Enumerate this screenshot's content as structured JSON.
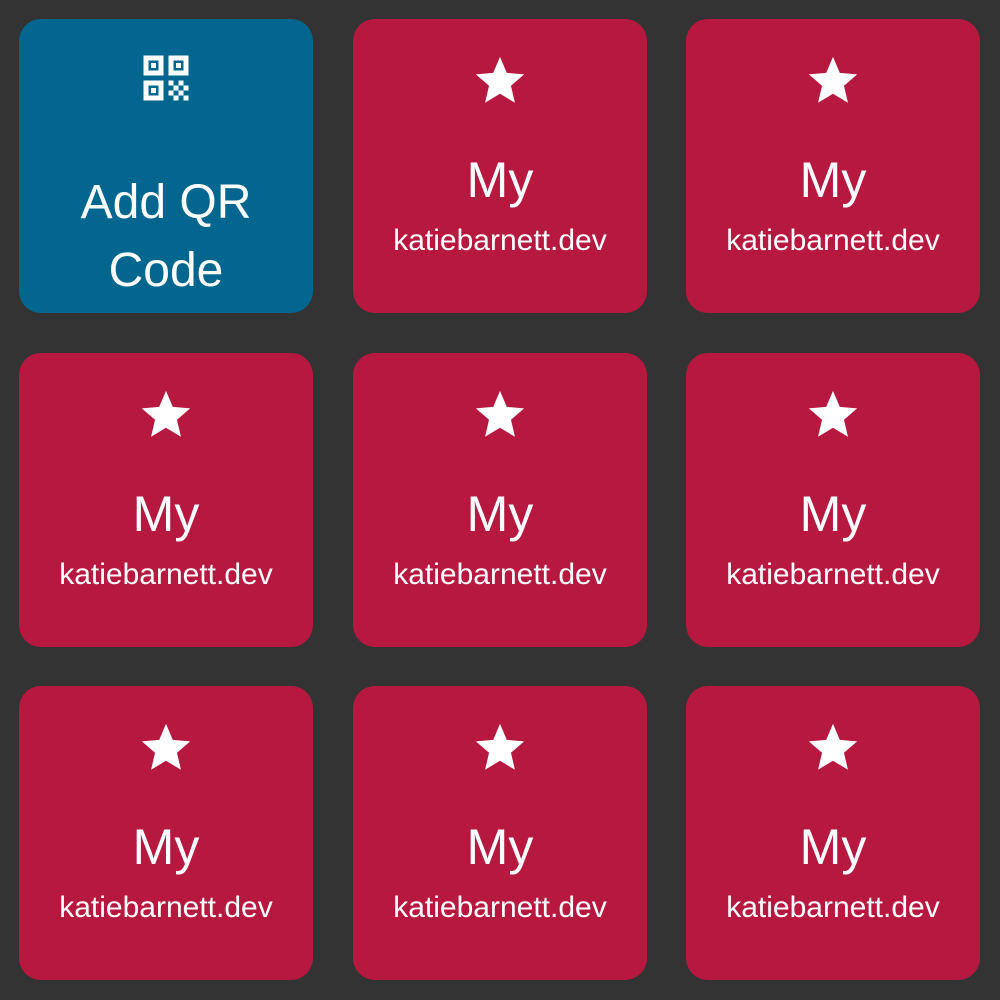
{
  "tiles": [
    {
      "kind": "add",
      "label": "Add QR Code",
      "icon": "qr-code-icon"
    },
    {
      "kind": "qr",
      "title": "My",
      "subtitle": "katiebarnett.dev",
      "icon": "star-icon"
    },
    {
      "kind": "qr",
      "title": "My",
      "subtitle": "katiebarnett.dev",
      "icon": "star-icon"
    },
    {
      "kind": "qr",
      "title": "My",
      "subtitle": "katiebarnett.dev",
      "icon": "star-icon"
    },
    {
      "kind": "qr",
      "title": "My",
      "subtitle": "katiebarnett.dev",
      "icon": "star-icon"
    },
    {
      "kind": "qr",
      "title": "My",
      "subtitle": "katiebarnett.dev",
      "icon": "star-icon"
    },
    {
      "kind": "qr",
      "title": "My",
      "subtitle": "katiebarnett.dev",
      "icon": "star-icon"
    },
    {
      "kind": "qr",
      "title": "My",
      "subtitle": "katiebarnett.dev",
      "icon": "star-icon"
    },
    {
      "kind": "qr",
      "title": "My",
      "subtitle": "katiebarnett.dev",
      "icon": "star-icon"
    }
  ],
  "colors": {
    "background": "#333333",
    "add_tile": "#02668f",
    "qr_tile": "#b71840",
    "foreground": "#ffffff"
  }
}
